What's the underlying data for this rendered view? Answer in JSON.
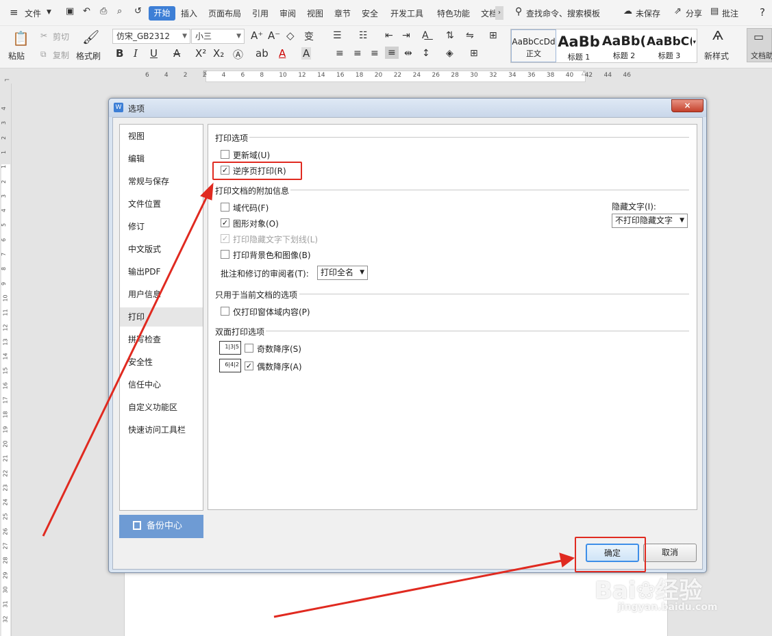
{
  "menubar": {
    "file": "文件",
    "tabs": [
      "开始",
      "插入",
      "页面布局",
      "引用",
      "审阅",
      "视图",
      "章节",
      "安全",
      "开发工具",
      "特色功能",
      "文档"
    ],
    "search": "查找命令、搜索模板",
    "unsaved": "未保存",
    "share": "分享",
    "comment": "批注",
    "help": "?"
  },
  "toolbar": {
    "paste": "粘贴",
    "cut": "剪切",
    "copy": "复制",
    "format_painter": "格式刷",
    "font_name": "仿宋_GB2312",
    "font_size": "小三",
    "styles": [
      {
        "preview": "AaBbCcDd",
        "name": "正文"
      },
      {
        "preview": "AaBb",
        "name": "标题 1"
      },
      {
        "preview": "AaBb(",
        "name": "标题 2"
      },
      {
        "preview": "AaBbC(",
        "name": "标题 3"
      }
    ],
    "new_style": "新样式",
    "doc_assist": "文档助"
  },
  "ruler": {
    "numbers": [
      "6",
      "4",
      "2",
      "2",
      "4",
      "6",
      "8",
      "10",
      "12",
      "14",
      "16",
      "18",
      "20",
      "22",
      "24",
      "26",
      "28",
      "30",
      "32",
      "34",
      "36",
      "38",
      "40",
      "42",
      "44",
      "46"
    ]
  },
  "vruler": {
    "numbers": [
      "4",
      "3",
      "2",
      "1",
      "1",
      "2",
      "3",
      "4",
      "5",
      "6",
      "7",
      "8",
      "9",
      "10",
      "11",
      "12",
      "13",
      "14",
      "15",
      "16",
      "17",
      "18",
      "19",
      "20",
      "21",
      "22",
      "23",
      "24",
      "25",
      "26",
      "27",
      "28",
      "29",
      "30",
      "31",
      "32"
    ]
  },
  "dialog": {
    "title": "选项",
    "close": "×",
    "nav": [
      "视图",
      "编辑",
      "常规与保存",
      "文件位置",
      "修订",
      "中文版式",
      "输出PDF",
      "用户信息",
      "打印",
      "拼写检查",
      "安全性",
      "信任中心",
      "自定义功能区",
      "快速访问工具栏"
    ],
    "selected_nav": "打印",
    "backup": "备份中心",
    "sections": {
      "print_options": "打印选项",
      "attach_info": "打印文档的附加信息",
      "current_doc": "只用于当前文档的选项",
      "duplex": "双面打印选项"
    },
    "options": {
      "update_fields": {
        "label": "更新域(U)",
        "checked": false
      },
      "reverse_order": {
        "label": "逆序页打印(R)",
        "checked": true
      },
      "field_codes": {
        "label": "域代码(F)",
        "checked": false
      },
      "drawing_objects": {
        "label": "图形对象(O)",
        "checked": true
      },
      "hidden_underline": {
        "label": "打印隐藏文字下划线(L)",
        "checked": true,
        "disabled": true
      },
      "background": {
        "label": "打印背景色和图像(B)",
        "checked": false
      },
      "form_only": {
        "label": "仅打印窗体域内容(P)",
        "checked": false
      },
      "odd_reverse": {
        "label": "奇数降序(S)",
        "checked": false
      },
      "even_reverse": {
        "label": "偶数降序(A)",
        "checked": true
      }
    },
    "hidden_text_label": "隐藏文字(I):",
    "hidden_text_value": "不打印隐藏文字",
    "reviewer_label": "批注和修订的审阅者(T):",
    "reviewer_value": "打印全名",
    "ok": "确定",
    "cancel": "取消",
    "duplex_odd_icon": "1|3|5",
    "duplex_even_icon": "6|4|2"
  },
  "watermark": {
    "logo": "Bai❀经验",
    "url": "jingyan.baidu.com"
  },
  "colors": {
    "accent": "#3d7fd6",
    "annotation": "#e02a20"
  }
}
